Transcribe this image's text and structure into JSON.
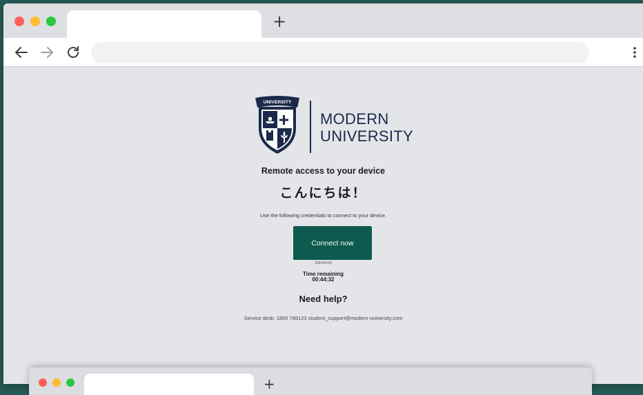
{
  "browser": {
    "new_tab_icon": "plus-icon",
    "back_icon": "arrow-left-icon",
    "forward_icon": "arrow-right-icon",
    "reload_icon": "reload-icon",
    "menu_icon": "kebab-menu-icon",
    "address": ""
  },
  "logo": {
    "badge_text": "UNIVERSITY",
    "line1": "MODERN",
    "line2": "UNIVERSITY"
  },
  "page": {
    "subtitle": "Remote access to your device",
    "greeting": "こんにちは！",
    "instructions": "Use the following credentials to connect to your device.",
    "connect_label": "Connect now",
    "code": "318434156",
    "time_label": "Time remaining",
    "time_value": "00:44:32",
    "help_heading": "Need help?",
    "service_desk": "Service desk: 1800 789123 student_support@modern-university.com"
  },
  "colors": {
    "accent": "#0e5a4f",
    "brand": "#1b2a4a",
    "background": "#e4e5e9",
    "desktop": "#255a55"
  }
}
